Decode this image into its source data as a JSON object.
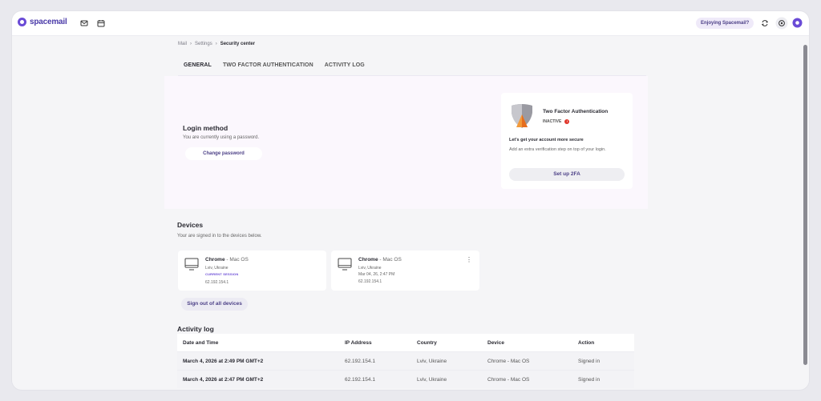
{
  "app": {
    "logo_text": "spacemail",
    "enjoy_label": "Enjoying Spacemail?"
  },
  "breadcrumb": [
    "Mail",
    "Settings",
    "Security center"
  ],
  "tabs": [
    {
      "label": "GENERAL",
      "active": true
    },
    {
      "label": "TWO FACTOR AUTHENTICATION",
      "active": false
    },
    {
      "label": "ACTIVITY LOG",
      "active": false
    }
  ],
  "login_method": {
    "title": "Login method",
    "subtitle": "You are currently using a password.",
    "button": "Change password"
  },
  "two_factor": {
    "title": "Two Factor Authentication",
    "status": "INACTIVE",
    "status_mark": "!",
    "heading": "Let's get your account more secure",
    "description": "Add an extra verification step on top of your login.",
    "button": "Set up 2FA"
  },
  "devices": {
    "title": "Devices",
    "subtitle": "Your are signed in to the devices below.",
    "items": [
      {
        "browser": "Chrome",
        "os": " - Mac OS",
        "location": "Lviv, Ukraine",
        "badge": "CURRENT SESSION",
        "ip": "62.192.154.1"
      },
      {
        "browser": "Chrome",
        "os": " - Mac OS",
        "location": "Lviv, Ukraine",
        "time": "Mar 04, 26, 2:47 PM",
        "ip": "62.192.154.1"
      }
    ],
    "sign_out_all": "Sign out of all devices"
  },
  "activity_log": {
    "title": "Activity log",
    "columns": [
      "Date and Time",
      "IP Address",
      "Country",
      "Device",
      "Action"
    ],
    "rows": [
      [
        "March 4, 2026 at 2:49 PM GMT+2",
        "62.192.154.1",
        "Lviv, Ukraine",
        "Chrome - Mac OS",
        "Signed in"
      ],
      [
        "March 4, 2026 at 2:47 PM GMT+2",
        "62.192.154.1",
        "Lviv, Ukraine",
        "Chrome - Mac OS",
        "Signed in"
      ]
    ]
  },
  "colors": {
    "accent": "#6a4bd6",
    "alert": "#e0362b"
  }
}
